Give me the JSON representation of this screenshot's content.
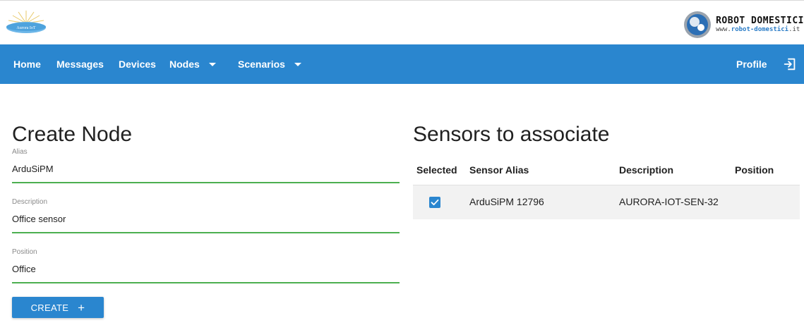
{
  "brand": {
    "left_logo_text": "Aurora IoT",
    "right_logo_title": "ROBOT DOMESTICI",
    "right_logo_url_prefix": "www.",
    "right_logo_url_highlight": "robot-domestici",
    "right_logo_url_suffix": ".it"
  },
  "nav": {
    "home": "Home",
    "messages": "Messages",
    "devices": "Devices",
    "nodes": "Nodes",
    "scenarios": "Scenarios",
    "profile": "Profile"
  },
  "form": {
    "title": "Create Node",
    "alias_label": "Alias",
    "alias_value": "ArduSiPM",
    "description_label": "Description",
    "description_value": "Office sensor",
    "position_label": "Position",
    "position_value": "Office",
    "create_label": "CREATE",
    "create_icon": "+"
  },
  "sensors": {
    "title": "Sensors to associate",
    "columns": [
      "Selected",
      "Sensor Alias",
      "Description",
      "Position"
    ],
    "rows": [
      {
        "selected": true,
        "alias": "ArduSiPM 12796",
        "description": "AURORA-IOT-SEN-32",
        "position": ""
      }
    ]
  },
  "colors": {
    "accent": "#2a86cf",
    "field_underline": "#4caf50",
    "row_background": "#f2f2f2"
  }
}
